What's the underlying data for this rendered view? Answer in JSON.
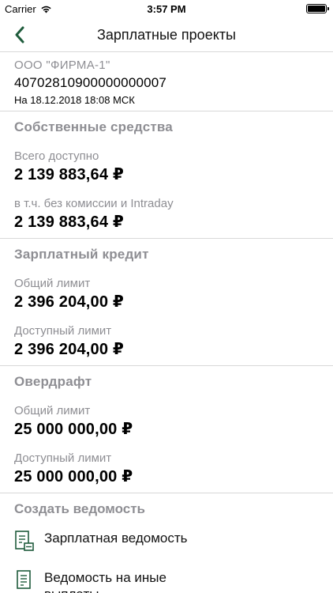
{
  "status_bar": {
    "carrier": "Carrier",
    "time": "3:57 PM"
  },
  "nav": {
    "title": "Зарплатные проекты"
  },
  "account": {
    "company": "ООО \"ФИРМА-1\"",
    "number": "40702810900000000007",
    "date": "На 18.12.2018 18:08 МСК"
  },
  "sections": [
    {
      "title": "Собственные средства",
      "items": [
        {
          "label": "Всего доступно",
          "value": "2 139 883,64 ₽"
        },
        {
          "label": "в т.ч. без комиссии и Intraday",
          "value": "2 139 883,64 ₽"
        }
      ]
    },
    {
      "title": "Зарплатный кредит",
      "items": [
        {
          "label": "Общий лимит",
          "value": "2 396 204,00 ₽"
        },
        {
          "label": "Доступный лимит",
          "value": "2 396 204,00 ₽"
        }
      ]
    },
    {
      "title": "Овердрафт",
      "items": [
        {
          "label": "Общий лимит",
          "value": "25 000 000,00 ₽"
        },
        {
          "label": "Доступный лимит",
          "value": "25 000 000,00 ₽"
        }
      ]
    }
  ],
  "create": {
    "title": "Создать ведомость",
    "actions": [
      {
        "label": "Зарплатная ведомость",
        "icon": "payroll-doc-icon"
      },
      {
        "label": "Ведомость на иные выплаты",
        "icon": "document-icon"
      }
    ]
  },
  "colors": {
    "accent": "#1f5c3c",
    "secondary_text": "#8e8e93",
    "divider": "#d8d8d8"
  }
}
